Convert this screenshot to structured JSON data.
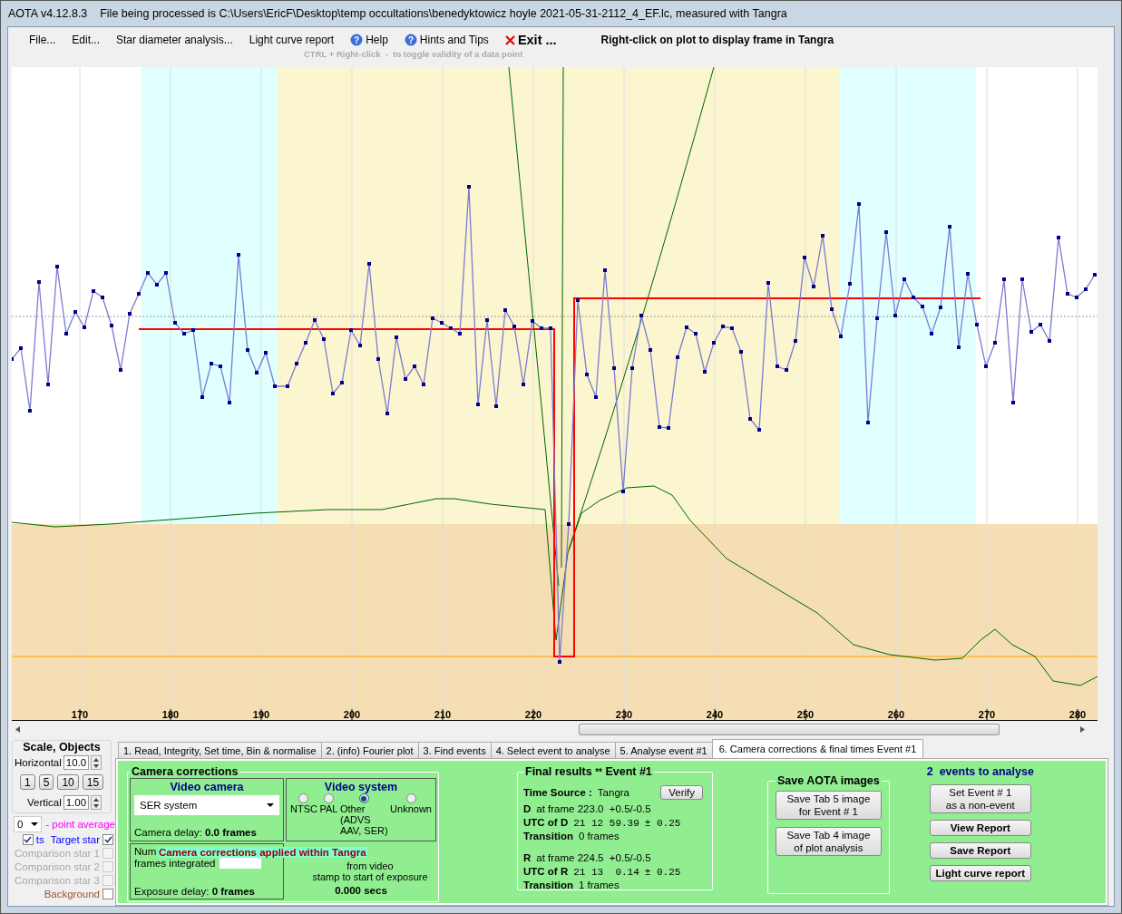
{
  "window": {
    "title": "AOTA v4.12.8.3    File being processed is C:\\Users\\EricF\\Desktop\\temp occultations\\benedyktowicz hoyle 2021-05-31-2112_4_EF.lc, measured with Tangra"
  },
  "menu": [
    {
      "label": "File...",
      "kind": "plain"
    },
    {
      "label": "Edit...",
      "kind": "plain"
    },
    {
      "label": "Star diameter analysis...",
      "kind": "plain"
    },
    {
      "label": "Light curve report",
      "kind": "plain"
    },
    {
      "label": "Help",
      "kind": "help",
      "icon": "?"
    },
    {
      "label": "Hints and Tips",
      "kind": "help",
      "icon": "?"
    },
    {
      "label": "Exit ...",
      "kind": "exit"
    }
  ],
  "plot_hint": "Right-click on plot to display frame in Tangra",
  "toggle_hint": "CTRL + Right-click  -  to toggle validity of a data point",
  "plot": {
    "x_ticks": [
      "170",
      "180",
      "190",
      "200",
      "210",
      "220",
      "230",
      "240",
      "250",
      "260",
      "270",
      "280"
    ]
  },
  "scale_panel": {
    "title": "Scale,  Objects",
    "horizontal_label": "Horizontal",
    "horizontal_value": "10.0",
    "zoom_buttons": [
      "1",
      "5",
      "10",
      "15"
    ],
    "vertical_label": "Vertical",
    "vertical_value": "1.00",
    "average_value": "0",
    "average_label": "- point average"
  },
  "dots": {
    "label": "ts",
    "checked": true
  },
  "objects": [
    {
      "label": "Target star",
      "checked": true,
      "disabled": false,
      "kind": "target"
    },
    {
      "label": "Comparison star 1",
      "checked": false,
      "disabled": true
    },
    {
      "label": "Comparison star 2",
      "checked": false,
      "disabled": true
    },
    {
      "label": "Comparison star 3",
      "checked": false,
      "disabled": true
    },
    {
      "label": "Background",
      "checked": false,
      "disabled": false,
      "kind": "background"
    }
  ],
  "tabs": [
    {
      "label": "1.  Read, Integrity, Set time, Bin & normalise",
      "selected": false
    },
    {
      "label": "2. (info)  Fourier plot",
      "selected": false
    },
    {
      "label": "3. Find events",
      "selected": false
    },
    {
      "label": "4. Select event to analyse",
      "selected": false
    },
    {
      "label": "5. Analyse event #1",
      "selected": false
    },
    {
      "label": "6. Camera corrections & final times Event #1",
      "selected": true
    }
  ],
  "camera_corrections": {
    "title": "Camera corrections",
    "video_camera_title": "Video camera",
    "camera_value": "SER system",
    "camera_delay_label": "Camera delay:",
    "camera_delay_value": "0.0 frames",
    "video_system_title": "Video system",
    "video_systems": [
      {
        "label": "NTSC",
        "selected": false
      },
      {
        "label": "PAL",
        "selected": false
      },
      {
        "label": "Other\n(ADVS\nAAV, SER)",
        "selected": true
      },
      {
        "label": "Unknown",
        "selected": false
      }
    ],
    "frames_label_1": "Num",
    "frames_label_2": "frames integrated",
    "banner": "Camera corrections applied within Tangra",
    "offset_text": "from video\nstamp to start of exposure",
    "offset_value": "0.000 secs",
    "exposure_delay_label": "Exposure delay:",
    "exposure_delay_value": "0 frames"
  },
  "final_results": {
    "title": "Final results",
    "marker": "**",
    "event": "Event #1",
    "verify": "Verify",
    "time_source_label": "Time Source :",
    "time_source_value": "Tangra",
    "events": [
      {
        "letter": "D",
        "frame": "at frame 223.0  +0.5/-0.5",
        "utc_label": "UTC of D",
        "utc": "21 12 59.39",
        "error": "± 0.25",
        "transition_label": "Transition",
        "transition": "0 frames"
      },
      {
        "letter": "R",
        "frame": "at frame 224.5  +0.5/-0.5",
        "utc_label": "UTC of R",
        "utc": "21 13  0.14",
        "error": "± 0.25",
        "transition_label": "Transition",
        "transition": "1 frames"
      }
    ]
  },
  "save_images": {
    "title": "Save AOTA images",
    "buttons": [
      "Save Tab 5 image\nfor Event # 1",
      "Save Tab 4 image\nof plot analysis"
    ]
  },
  "events_panel": {
    "count": "2",
    "title": "events to analyse",
    "buttons": [
      {
        "label": "Set Event # 1\nas a non-event",
        "kind": "plain"
      },
      {
        "label": "View Report",
        "kind": "bold"
      },
      {
        "label": "Save Report",
        "kind": "bold"
      },
      {
        "label": "Light curve report",
        "kind": "bold"
      }
    ]
  }
}
